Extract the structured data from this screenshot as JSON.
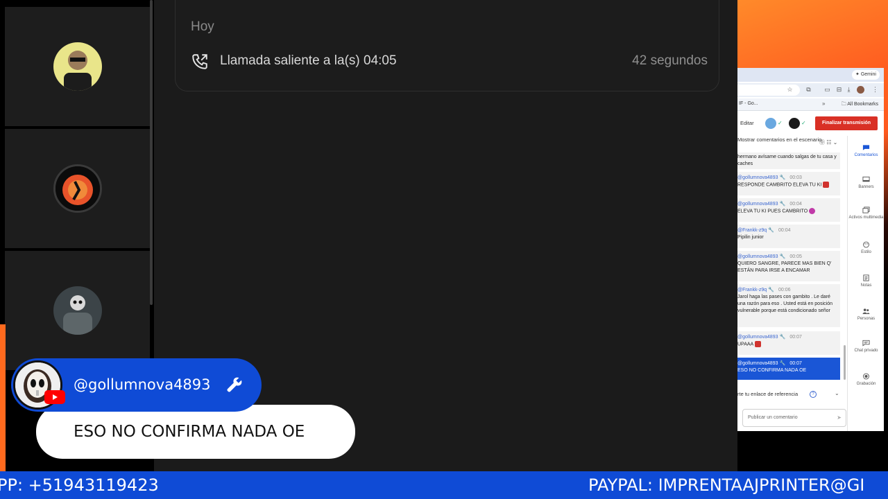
{
  "call_log": {
    "day": "Hoy",
    "entry_text": "Llamada saliente a la(s) 04:05",
    "duration": "42 segundos"
  },
  "browser": {
    "gemini_label": "Gemini",
    "tab_text": "IF - Go...",
    "bookmarks_label": "All Bookmarks"
  },
  "studio": {
    "edit_label": "Editar",
    "end_stream_label": "Finalizar transmisión",
    "show_comments_label": "Mostrar comentarios en el escenario",
    "messages": [
      {
        "author": "",
        "time": "",
        "body": "hermano avísame cuando salgas de tu casa y caches"
      },
      {
        "author": "@gollumnova4893",
        "time": "00:03",
        "body": "RESPONDE CAMBRITO ELEVA TU KI"
      },
      {
        "author": "@gollumnova4893",
        "time": "00:04",
        "body": "ELEVA TU KI PUES CAMBRITO"
      },
      {
        "author": "@Frankk-z9q",
        "time": "00:04",
        "body": "Pipilin junior"
      },
      {
        "author": "@gollumnova4893",
        "time": "00:05",
        "body": "QUIERO SANGRE, PARECE MAS BIEN Q' ESTÁN PARA IRSE A ENCAMAR"
      },
      {
        "author": "@Frankk-z9q",
        "time": "00:06",
        "body": "Jarol haga las pases con gambito . Le daré una razón para eso . Usted está en posición vulnerable porque está condicionado señor"
      },
      {
        "author": "@gollumnova4893",
        "time": "00:07",
        "body": "UPAAA"
      },
      {
        "author": "@gollumnova4893",
        "time": "00:07",
        "body": "ESO NO CONFIRMA NADA OE"
      }
    ],
    "referral_label": "rte tu enlace de referencia",
    "comment_placeholder": "Publicar un comentario",
    "rail": [
      {
        "label": "Comentarios",
        "icon": "comment-icon"
      },
      {
        "label": "Banners",
        "icon": "banner-icon"
      },
      {
        "label": "Activos multimedia",
        "icon": "media-icon"
      },
      {
        "label": "Estilo",
        "icon": "palette-icon"
      },
      {
        "label": "Notas",
        "icon": "notes-icon"
      },
      {
        "label": "Personas",
        "icon": "people-icon"
      },
      {
        "label": "Chat privado",
        "icon": "chat-icon"
      },
      {
        "label": "Grabación",
        "icon": "record-icon"
      }
    ]
  },
  "overlay": {
    "username": "@gollumnova4893",
    "message": "ESO NO CONFIRMA NADA OE"
  },
  "ticker": {
    "left_text": "PP: +51943119423",
    "right_text": "PAYPAL: IMPRENTAAJPRINTER@GI"
  },
  "colors": {
    "brand_blue": "#0f4bd6",
    "accent_orange": "#ff6a1e",
    "end_red": "#d93025"
  }
}
